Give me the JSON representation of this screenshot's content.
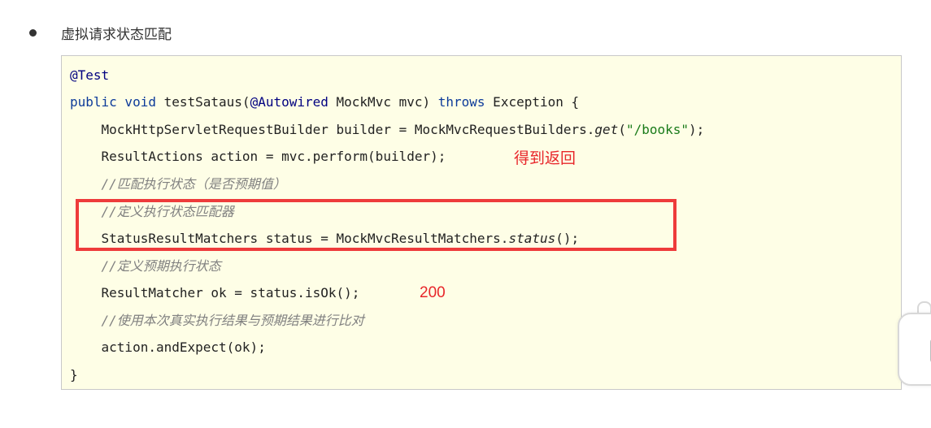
{
  "bullet": {
    "text": "虚拟请求状态匹配"
  },
  "code": {
    "l1": "@Test",
    "l2_kw1": "public void",
    "l2_name": " testSataus(",
    "l2_ann": "@Autowired",
    "l2_mid": " MockMvc mvc) ",
    "l2_kw2": "throws",
    "l2_end": " Exception {",
    "l3_a": "    MockHttpServletRequestBuilder builder = MockMvcRequestBuilders.",
    "l3_it": "get",
    "l3_b": "(",
    "l3_str": "\"/books\"",
    "l3_c": ");",
    "l4": "    ResultActions action = mvc.perform(builder);",
    "l5": "    //匹配执行状态（是否预期值）",
    "l6": "    //定义执行状态匹配器",
    "l7_a": "    StatusResultMatchers status = MockMvcResultMatchers.",
    "l7_it": "status",
    "l7_b": "();",
    "l8": "    //定义预期执行状态",
    "l9": "    ResultMatcher ok = status.isOk();",
    "l10": "    //使用本次真实执行结果与预期结果进行比对",
    "l11": "    action.andExpect(ok);",
    "l12": "}"
  },
  "annotations": {
    "get_return": "得到返回",
    "status_200": "200"
  },
  "colors": {
    "code_bg": "#fefee6",
    "highlight": "#ee3b3b",
    "note": "#e8262a"
  }
}
